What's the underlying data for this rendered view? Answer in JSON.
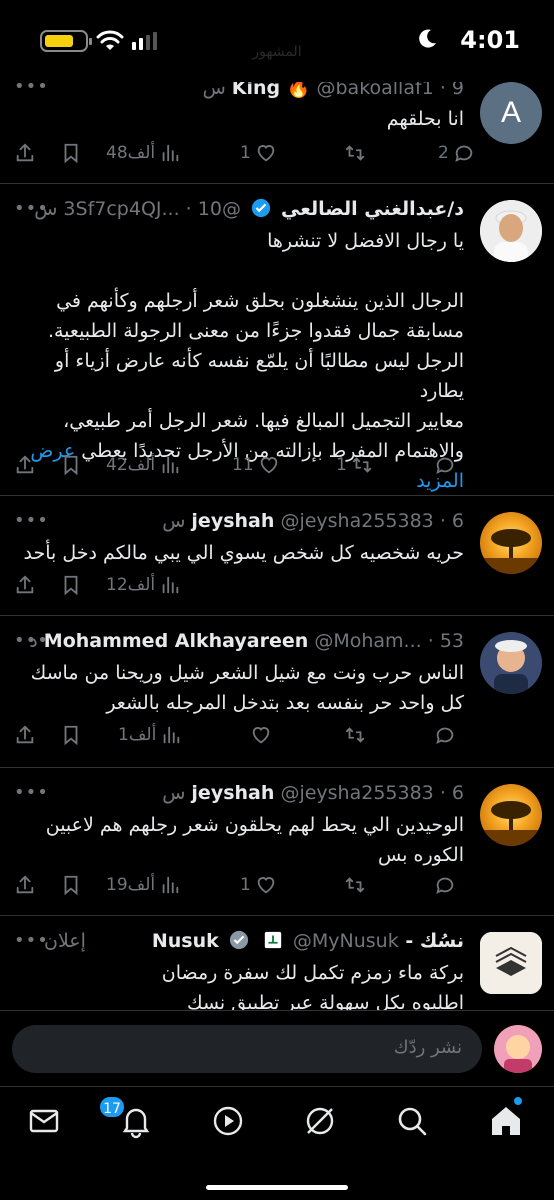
{
  "status_bar": {
    "time": "4:01",
    "behind_text": "المشهور"
  },
  "tweets": [
    {
      "name": "King 🔥",
      "handle": "@bakoallaf1",
      "age": "9 س",
      "text": [
        "انا بحلقهم"
      ],
      "replies": "2",
      "retweets": "",
      "likes": "1",
      "views": "48ألف",
      "avatar_letter": "A",
      "avatar_color": "#5b7083"
    },
    {
      "name": "د/عبدالغني الضالعي",
      "handle": "@3Sf7cp4QJ...",
      "age": "10 س",
      "text": [
        "يا رجال الافضل لا تنشرها",
        "",
        "الرجال الذين ينشغلون بحلق شعر أرجلهم وكأنهم في",
        "مسابقة جمال فقدوا جزءًا من معنى الرجولة الطبيعية.",
        "الرجل ليس مطالبًا أن يلمّع نفسه كأنه عارض أزياء أو يطارد",
        "معايير التجميل المبالغ فيها. شعر الرجل أمر طبيعي،",
        "والاهتمام المفرط بإزالته من الأرجل تحديدًا يعطي"
      ],
      "show_more": "عرض المزيد",
      "replies": "",
      "retweets": "1",
      "likes": "11",
      "views": "42ألف"
    },
    {
      "name": "jeyshah",
      "handle": "@jeysha255383",
      "age": "6 س",
      "text": [
        "حريه شخصيه كل شخص يسوي الي يبي مالكم دخل بأحد"
      ],
      "views": "12ألف"
    },
    {
      "name": "Mohammed Alkhayareen",
      "handle": "@Moham...",
      "age": "53 د",
      "text": [
        "الناس حرب ونت مع شيل الشعر شيل وريحنا من ماسك",
        "كل واحد حر بنفسه بعد بتدخل المرجله بالشعر"
      ],
      "replies": "",
      "retweets": "",
      "likes": "",
      "views": "1ألف"
    },
    {
      "name": "jeyshah",
      "handle": "@jeysha255383",
      "age": "6 س",
      "text": [
        "الوحيدين الي يحط لهم يحلقون شعر رجلهم هم لاعبين",
        "الكوره بس"
      ],
      "replies": "",
      "retweets": "",
      "likes": "1",
      "views": "19ألف"
    },
    {
      "name": "نسُك - Nusuk",
      "handle": "@MyNusuk",
      "ad_label": "إعلان",
      "text": [
        "بركة ماء زمزم تكمل لك سفرة رمضان",
        "اطلبوه بكل سهولة عبر تطبيق نسك"
      ]
    }
  ],
  "reply_bar": {
    "placeholder": "نشر ردّك"
  },
  "nav": {
    "notifications_badge": "17"
  },
  "colors": {
    "accent": "#1d9bf0",
    "muted": "#71767b",
    "background": "#000000",
    "verified": "#1d9bf0"
  }
}
